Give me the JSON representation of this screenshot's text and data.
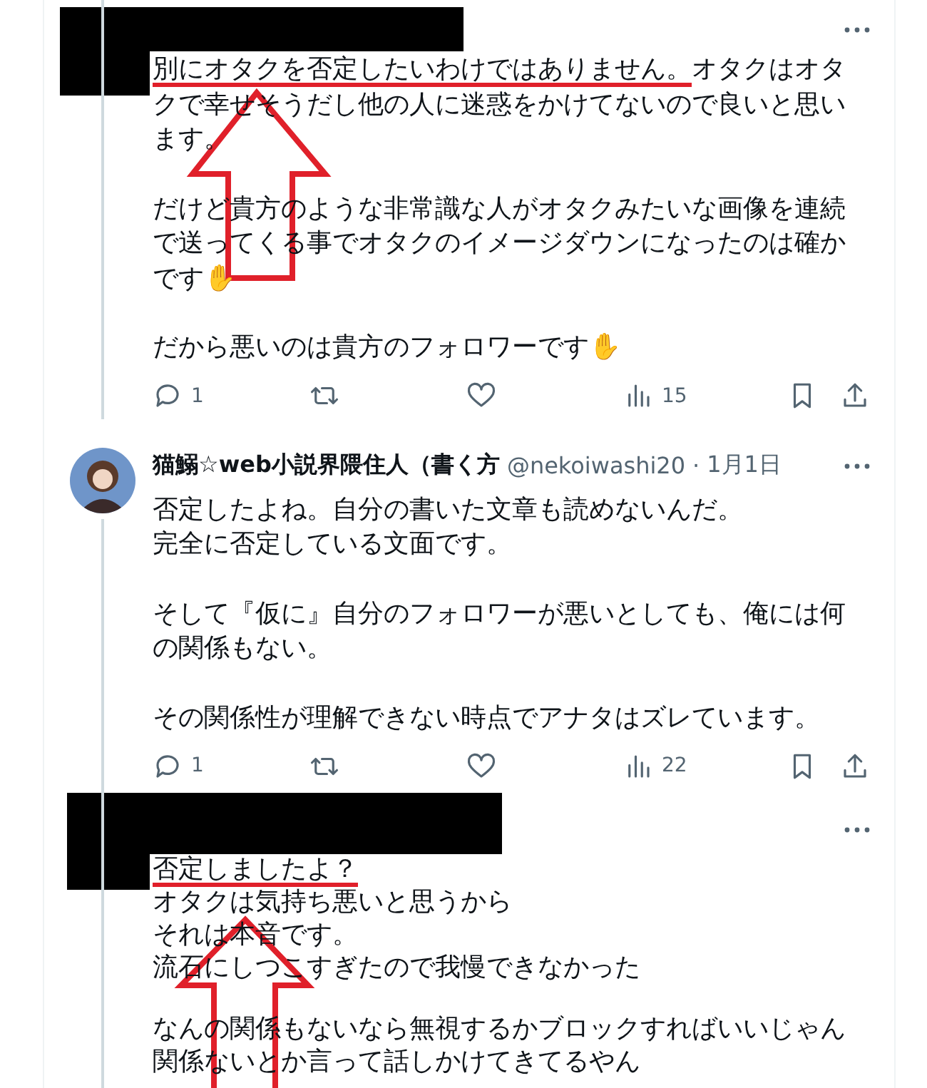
{
  "tweets": [
    {
      "redacted": true,
      "marked": true,
      "paragraphs": [
        [
          {
            "underlined": "別にオタクを否定したいわけではありません。",
            "text": "オタクはオタクで幸せそうだし他の人に迷惑をかけてないので良いと思います。"
          }
        ],
        [
          {
            "text": "だけど貴方のような非常識な人がオタクみたいな画像を連続で送ってくる事でオタクのイメージダウンになったのは確かです✋"
          }
        ],
        [
          {
            "text": "だから悪いのは貴方のフォロワーです✋"
          }
        ]
      ],
      "replies": "1",
      "views": "15"
    },
    {
      "redacted": false,
      "marked": false,
      "author": {
        "name": "猫鰯☆web小説界隈住人（書く方",
        "handle": "@nekoiwashi20"
      },
      "separator": "·",
      "date": "1月1日",
      "paragraphs": [
        [
          {
            "text": "否定したよね。自分の書いた文章も読めないんだ。"
          },
          {
            "text": "完全に否定している文面です。"
          }
        ],
        [
          {
            "text": "そして『仮に』自分のフォロワーが悪いとしても、俺には何の関係もない。"
          }
        ],
        [
          {
            "text": "その関係性が理解できない時点でアナタはズレています。"
          }
        ]
      ],
      "replies": "1",
      "views": "22"
    },
    {
      "redacted": true,
      "marked": true,
      "paragraphs": [
        [
          {
            "underlined": "否定しましたよ？"
          },
          {
            "text": "オタクは気持ち悪いと思うから"
          },
          {
            "text": "それは本音です。"
          },
          {
            "text": "流石にしつこすぎたので我慢できなかった"
          }
        ],
        [
          {
            "text": "なんの関係もないなら無視するかブロックすればいいじゃん"
          },
          {
            "text": "関係ないとか言って話しかけてきてるやん"
          }
        ]
      ]
    }
  ]
}
